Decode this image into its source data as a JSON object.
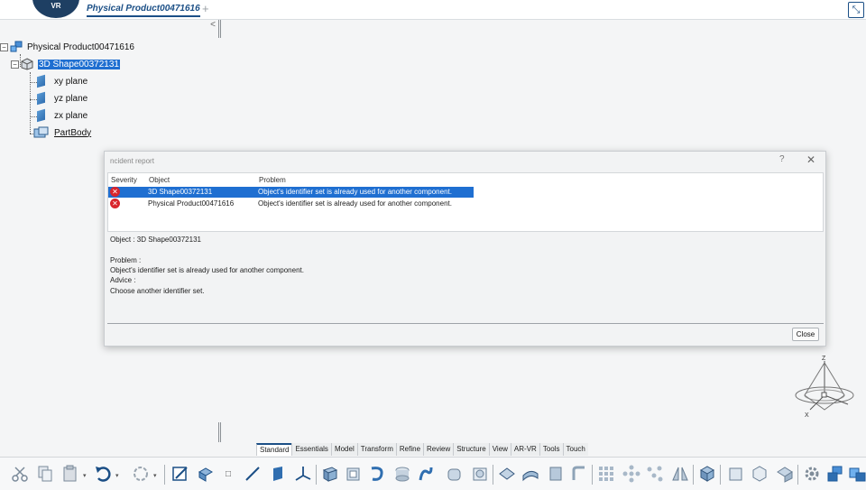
{
  "topbar": {
    "logo_text": "VR",
    "tab_title": "Physical Product00471616",
    "tab_add": "+"
  },
  "tree": {
    "collapse": "<",
    "root": "Physical Product00471616",
    "shape": "3D Shape00372131",
    "planes": [
      "xy plane",
      "yz plane",
      "zx plane"
    ],
    "body": "PartBody"
  },
  "dialog": {
    "title": "ncident report",
    "help": "?",
    "close_x": "✕",
    "columns": [
      "Severity",
      "Object",
      "Problem"
    ],
    "rows": [
      {
        "object": "3D Shape00372131",
        "problem": "Object's identifier set is already used for another component.",
        "selected": true
      },
      {
        "object": "Physical Product00471616",
        "problem": "Object's identifier set is already used for another component.",
        "selected": false
      }
    ],
    "detail_object": "Object : 3D Shape00372131",
    "detail_problem_label": "Problem :",
    "detail_problem": "Object's identifier set is already used for another component.",
    "detail_advice_label": "Advice :",
    "detail_advice": "Choose another identifier set.",
    "close_button": "Close"
  },
  "compass": {
    "z": "Z",
    "x": "X"
  },
  "bottom_tabs": [
    "Standard",
    "Essentials",
    "Model",
    "Transform",
    "Refine",
    "Review",
    "Structure",
    "View",
    "AR-VR",
    "Tools",
    "Touch"
  ],
  "active_tab": "Standard",
  "colors": {
    "accent": "#1b4f86",
    "selection": "#1f6fd1",
    "error": "#d9262d"
  }
}
